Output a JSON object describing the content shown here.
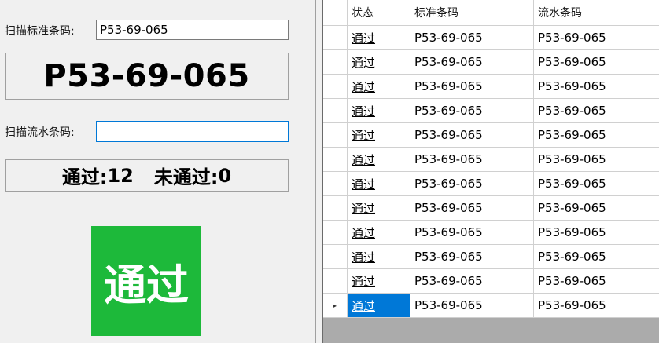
{
  "scan_standard": {
    "label": "扫描标准条码:",
    "value": "P53-69-065"
  },
  "display_code": "P53-69-065",
  "scan_serial": {
    "label": "扫描流水条码:",
    "value": ""
  },
  "counts": {
    "pass_label": "通过:",
    "pass_value": "12",
    "fail_label": "未通过:",
    "fail_value": "0"
  },
  "status": {
    "text": "通过",
    "color": "#1db93a"
  },
  "grid": {
    "columns": [
      "状态",
      "标准条码",
      "流水条码"
    ],
    "rows": [
      {
        "status": "通过",
        "standard": "P53-69-065",
        "serial": "P53-69-065"
      },
      {
        "status": "通过",
        "standard": "P53-69-065",
        "serial": "P53-69-065"
      },
      {
        "status": "通过",
        "standard": "P53-69-065",
        "serial": "P53-69-065"
      },
      {
        "status": "通过",
        "standard": "P53-69-065",
        "serial": "P53-69-065"
      },
      {
        "status": "通过",
        "standard": "P53-69-065",
        "serial": "P53-69-065"
      },
      {
        "status": "通过",
        "standard": "P53-69-065",
        "serial": "P53-69-065"
      },
      {
        "status": "通过",
        "standard": "P53-69-065",
        "serial": "P53-69-065"
      },
      {
        "status": "通过",
        "standard": "P53-69-065",
        "serial": "P53-69-065"
      },
      {
        "status": "通过",
        "standard": "P53-69-065",
        "serial": "P53-69-065"
      },
      {
        "status": "通过",
        "standard": "P53-69-065",
        "serial": "P53-69-065"
      },
      {
        "status": "通过",
        "standard": "P53-69-065",
        "serial": "P53-69-065"
      },
      {
        "status": "通过",
        "standard": "P53-69-065",
        "serial": "P53-69-065"
      }
    ],
    "selected_row": 11,
    "row_indicator": "▸"
  }
}
